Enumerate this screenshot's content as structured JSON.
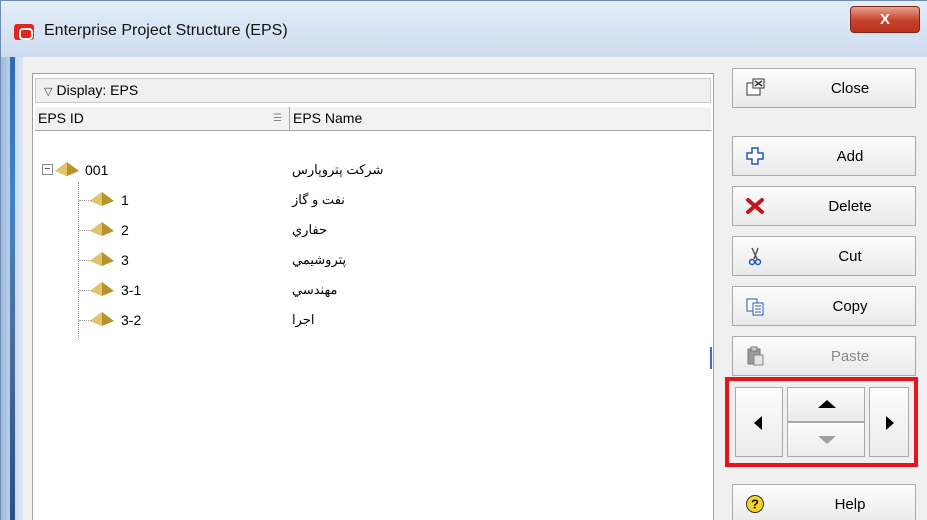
{
  "window": {
    "title": "Enterprise Project Structure (EPS)",
    "close_glyph": "X"
  },
  "grid": {
    "group_label": "Display: EPS",
    "columns": {
      "id": "EPS ID",
      "name": "EPS Name"
    },
    "rows": [
      {
        "id": "001",
        "name": "شرکت پتروپارس",
        "level": 0,
        "expanded": true
      },
      {
        "id": "1",
        "name": "نفت و گاز",
        "level": 1
      },
      {
        "id": "2",
        "name": "حفاري",
        "level": 1
      },
      {
        "id": "3",
        "name": "پتروشيمي",
        "level": 1
      },
      {
        "id": "3-1",
        "name": "مهندسي",
        "level": 1
      },
      {
        "id": "3-2",
        "name": "اجرا",
        "level": 1
      }
    ]
  },
  "sidebar": {
    "close": "Close",
    "add": "Add",
    "delete": "Delete",
    "cut": "Cut",
    "copy": "Copy",
    "paste": "Paste",
    "help": "Help"
  },
  "colors": {
    "highlight": "#e8141b",
    "node_icon": "#c9a227"
  }
}
